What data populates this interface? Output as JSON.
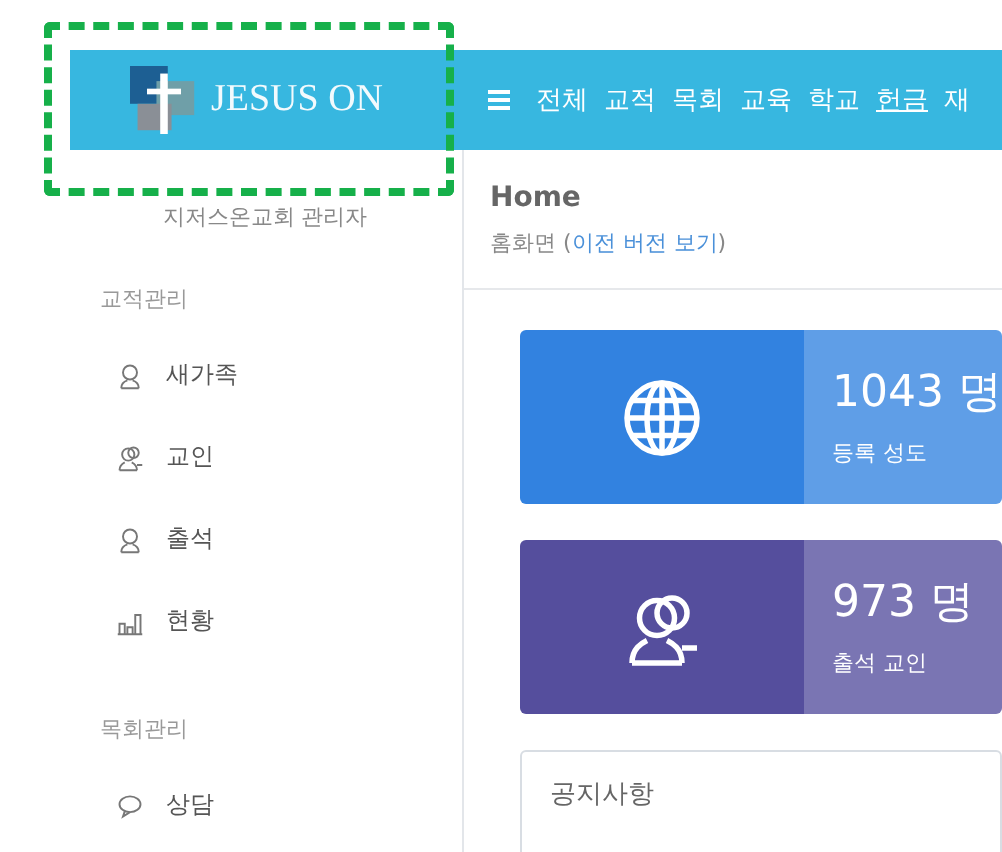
{
  "annotation": {
    "kind": "dashed-frame"
  },
  "logo": {
    "text": "JESUS ON"
  },
  "nav": {
    "items": [
      {
        "label": "전체",
        "underlined": false
      },
      {
        "label": "교적",
        "underlined": false
      },
      {
        "label": "목회",
        "underlined": false
      },
      {
        "label": "교육",
        "underlined": false
      },
      {
        "label": "학교",
        "underlined": false
      },
      {
        "label": "헌금",
        "underlined": true
      },
      {
        "label": "재",
        "underlined": false
      }
    ]
  },
  "sidebar": {
    "subtitle": "지저스온교회 관리자",
    "sections": [
      {
        "title": "교적관리",
        "items": [
          {
            "label": "새가족",
            "kind": "person"
          },
          {
            "label": "교인",
            "kind": "people"
          },
          {
            "label": "출석",
            "kind": "person"
          },
          {
            "label": "현황",
            "kind": "chart"
          }
        ]
      },
      {
        "title": "목회관리",
        "items": [
          {
            "label": "상담",
            "kind": "chat"
          }
        ]
      }
    ]
  },
  "header": {
    "title": "Home",
    "breadcrumb": "홈화면",
    "open_paren": "(",
    "link": "이전 버전 보기",
    "close_paren": ")"
  },
  "stats": [
    {
      "kind": "globe",
      "value": "1043 명",
      "label": "등록 성도",
      "color": "#3282e0"
    },
    {
      "kind": "people",
      "value": "973 명",
      "label": "출석 교인",
      "color": "#554e9d"
    }
  ],
  "notice": {
    "title": "공지사항"
  }
}
